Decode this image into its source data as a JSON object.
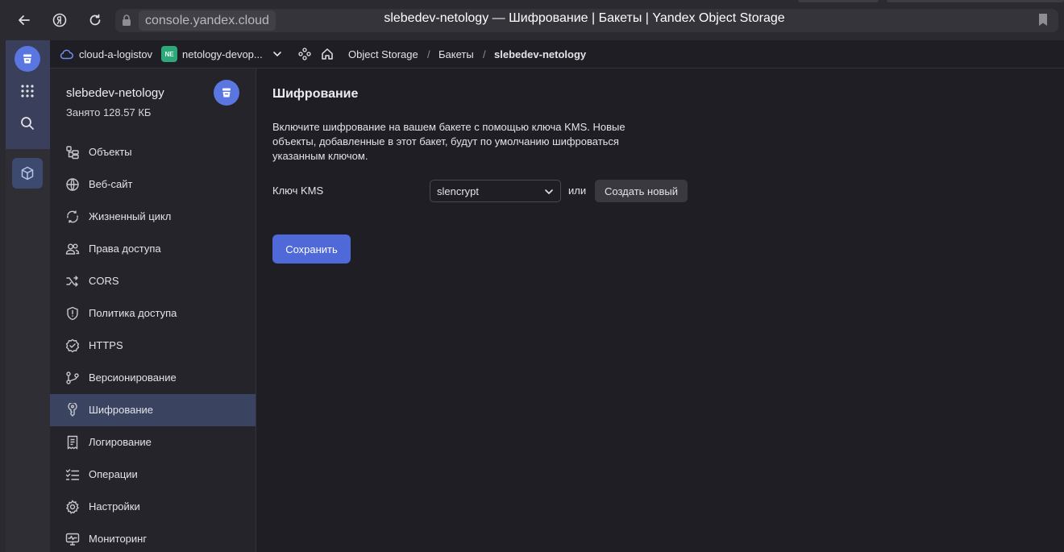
{
  "browser": {
    "url": "console.yandex.cloud",
    "title": "slebedev-netology — Шифрование | Бакеты | Yandex Object Storage"
  },
  "header": {
    "cloud": "cloud-a-logistov",
    "folder_badge": "NE",
    "folder": "netology-devop...",
    "breadcrumbs": [
      "Object Storage",
      "/",
      "Бакеты",
      "/",
      "slebedev-netology"
    ]
  },
  "sidebar": {
    "bucket_name": "slebedev-netology",
    "used": "Занято 128.57 КБ",
    "items": [
      {
        "label": "Объекты",
        "icon": "objects-icon"
      },
      {
        "label": "Веб-сайт",
        "icon": "globe-icon"
      },
      {
        "label": "Жизненный цикл",
        "icon": "lifecycle-icon"
      },
      {
        "label": "Права доступа",
        "icon": "users-icon"
      },
      {
        "label": "CORS",
        "icon": "shuffle-icon"
      },
      {
        "label": "Политика доступа",
        "icon": "shield-icon"
      },
      {
        "label": "HTTPS",
        "icon": "badge-check-icon"
      },
      {
        "label": "Версионирование",
        "icon": "branch-icon"
      },
      {
        "label": "Шифрование",
        "icon": "key-icon",
        "active": true
      },
      {
        "label": "Логирование",
        "icon": "receipt-icon"
      },
      {
        "label": "Операции",
        "icon": "list-check-icon"
      },
      {
        "label": "Настройки",
        "icon": "gear-icon"
      },
      {
        "label": "Мониторинг",
        "icon": "monitor-icon"
      }
    ]
  },
  "main": {
    "title": "Шифрование",
    "description": "Включите шифрование на вашем бакете с помощью ключа KMS. Новые объекты, добавленные в этот бакет, будут по умолчанию шифроваться указанным ключом.",
    "kms_label": "Ключ KMS",
    "kms_value": "slencrypt",
    "or": "или",
    "create_label": "Создать новый",
    "save_label": "Сохранить"
  },
  "colors": {
    "accent": "#5069d8",
    "active_item": "#3a4360",
    "folder_badge": "#2ea77a"
  }
}
